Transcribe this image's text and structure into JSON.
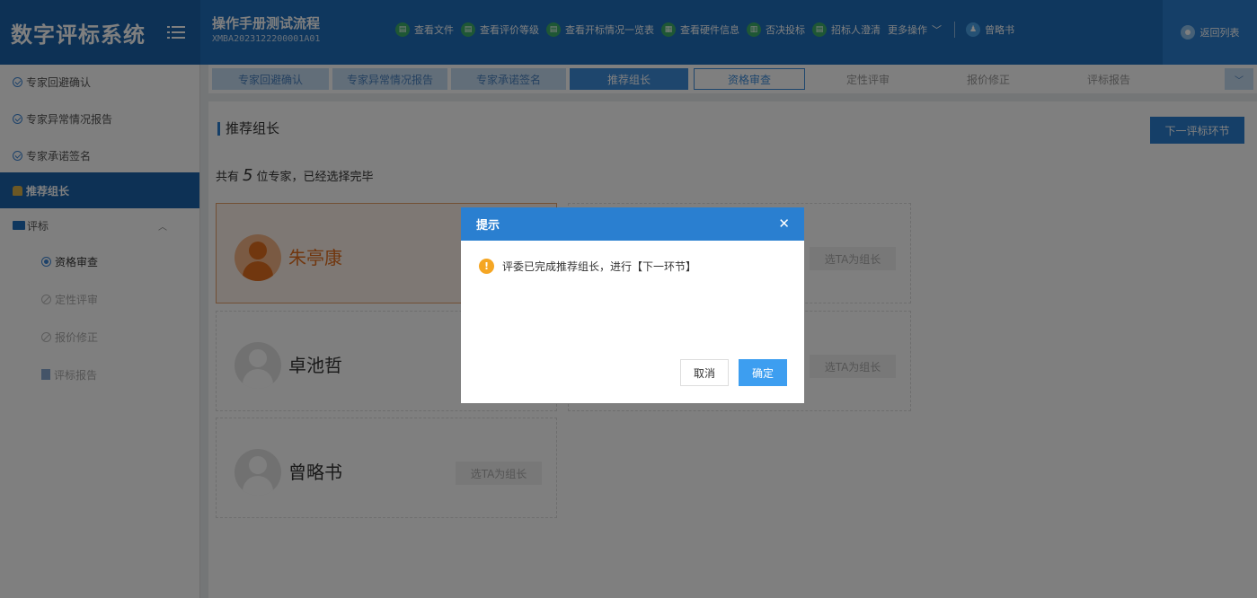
{
  "app": {
    "title": "数字评标系统"
  },
  "project": {
    "name": "操作手册测试流程",
    "code": "XMBA2023122200001A01"
  },
  "toolbar": {
    "actions": [
      "查看文件",
      "查看评价等级",
      "查看开标情况一览表",
      "查看硬件信息",
      "否决投标",
      "招标人澄清"
    ],
    "more": "更多操作",
    "user": "曾略书",
    "back": "返回列表"
  },
  "sidebar": {
    "items": [
      "专家回避确认",
      "专家异常情况报告",
      "专家承诺签名",
      "推荐组长"
    ],
    "group": "评标",
    "sub": [
      "资格审查",
      "定性评审",
      "报价修正",
      "评标报告"
    ]
  },
  "steps": [
    "专家回避确认",
    "专家异常情况报告",
    "专家承诺签名",
    "推荐组长",
    "资格审查",
    "定性评审",
    "报价修正",
    "评标报告"
  ],
  "main": {
    "title": "推荐组长",
    "next_button": "下一评标环节",
    "summary_prefix": "共有",
    "summary_count": "5",
    "summary_suffix": "位专家，已经选择完毕",
    "pick_label": "选TA为组长",
    "experts": [
      "朱亭康",
      "卓池哲",
      "曾略书"
    ]
  },
  "dialog": {
    "title": "提示",
    "message": "评委已完成推荐组长，进行【下一环节】",
    "cancel": "取消",
    "ok": "确定"
  }
}
